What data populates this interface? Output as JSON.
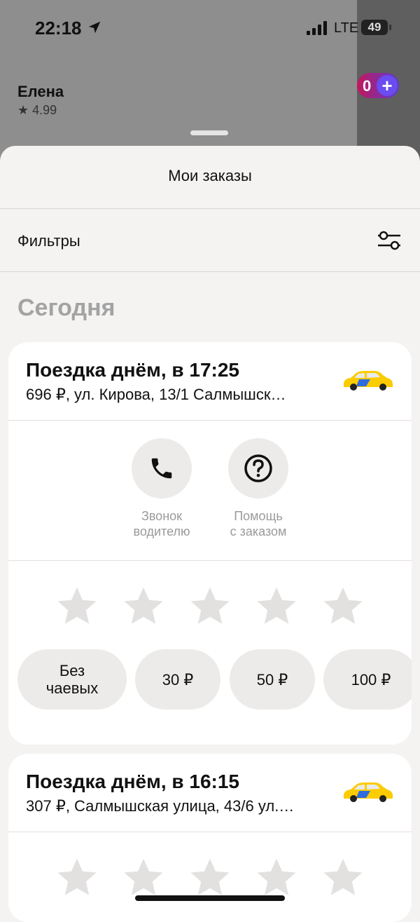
{
  "status_bar": {
    "time": "22:18",
    "network": "LTE",
    "battery": "49"
  },
  "profile": {
    "name": "Елена",
    "rating": "★ 4.99",
    "plus_count": "0"
  },
  "sheet": {
    "title": "Мои заказы",
    "filters_label": "Фильтры",
    "section_today": "Сегодня"
  },
  "orders": [
    {
      "title": "Поездка днём, в 17:25",
      "subtitle": "696 ₽, ул. Кирова, 13/1 Салмышск…",
      "actions": [
        {
          "label_line1": "Звонок",
          "label_line2": "водителю",
          "icon": "phone-icon"
        },
        {
          "label_line1": "Помощь",
          "label_line2": "с заказом",
          "icon": "question-icon"
        }
      ],
      "rating_stars": 5,
      "tips": [
        {
          "line1": "Без",
          "line2": "чаевых"
        },
        {
          "line1": "30 ₽",
          "line2": ""
        },
        {
          "line1": "50 ₽",
          "line2": ""
        },
        {
          "line1": "100 ₽",
          "line2": ""
        }
      ]
    },
    {
      "title": "Поездка днём, в 16:15",
      "subtitle": "307 ₽, Салмышская улица, 43/6 ул.…",
      "rating_stars": 5
    }
  ],
  "colors": {
    "sheet_bg": "#f4f3f1",
    "card_bg": "#ffffff",
    "pill_bg": "#ecebe9",
    "star": "#e2e1df",
    "muted_text": "#9a9a9a",
    "taxi_yellow": "#fccb00"
  }
}
